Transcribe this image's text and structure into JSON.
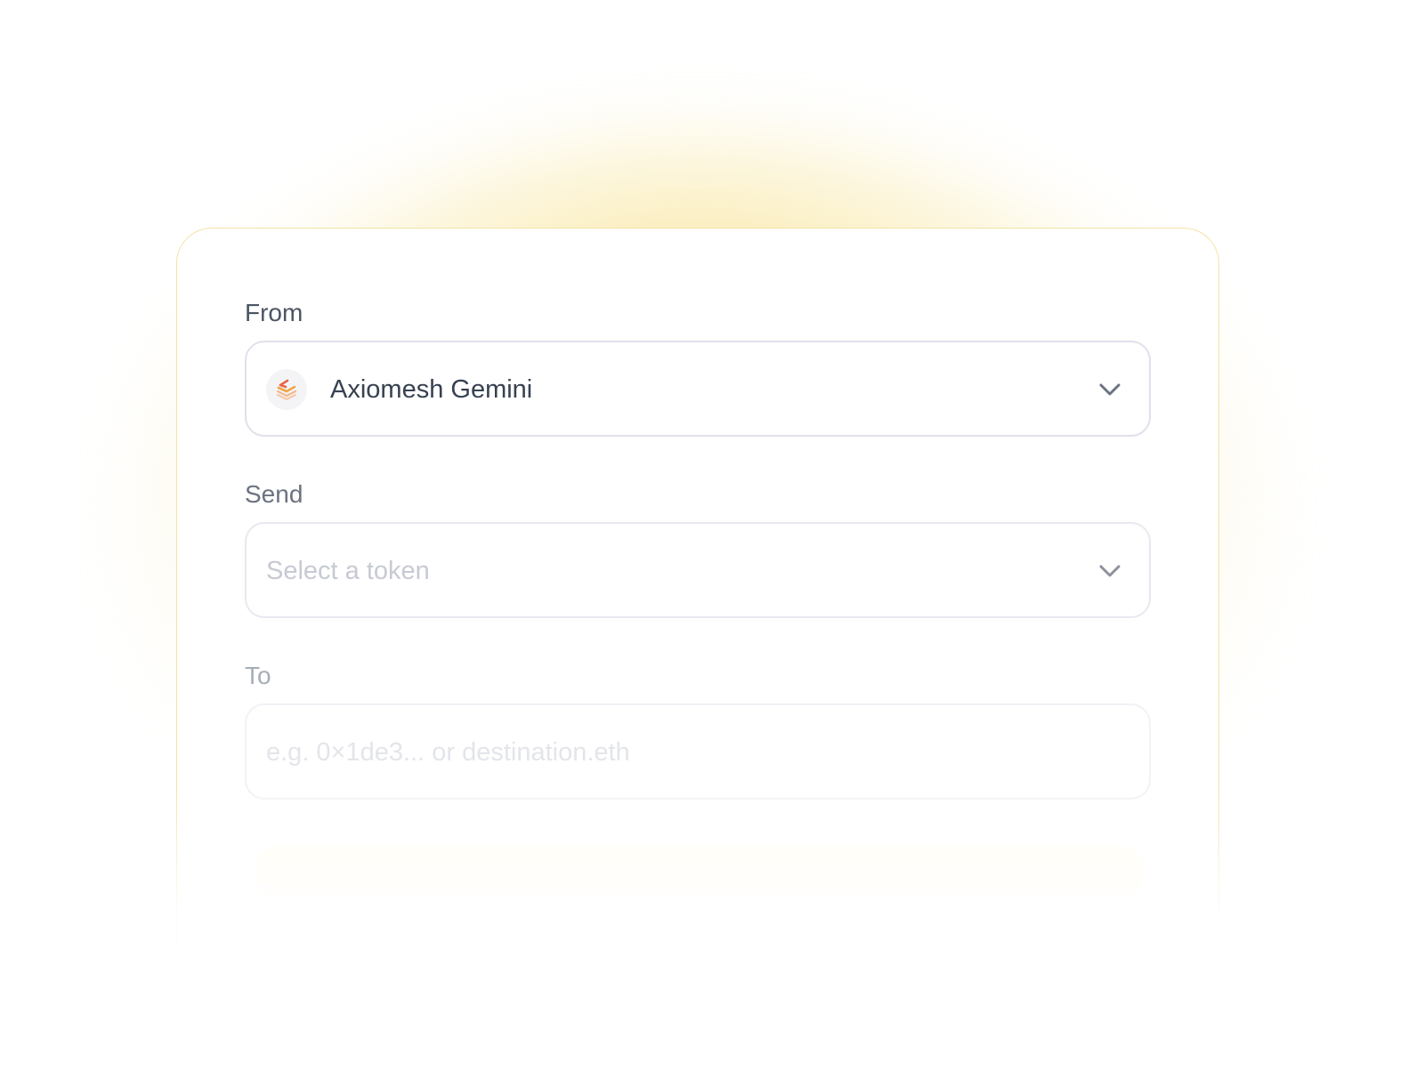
{
  "form": {
    "from": {
      "label": "From",
      "value": "Axiomesh Gemini",
      "icon": "axiomesh-logo-icon"
    },
    "send": {
      "label": "Send",
      "placeholder": "Select a token"
    },
    "to": {
      "label": "To",
      "placeholder": "e.g. 0×1de3... or destination.eth"
    }
  },
  "colors": {
    "glow": "#f0c948",
    "card_border": "#f3e3a6",
    "label": "#4b5563",
    "value_text": "#374151",
    "placeholder": "#c7cad3",
    "chevron": "#6b7280"
  }
}
